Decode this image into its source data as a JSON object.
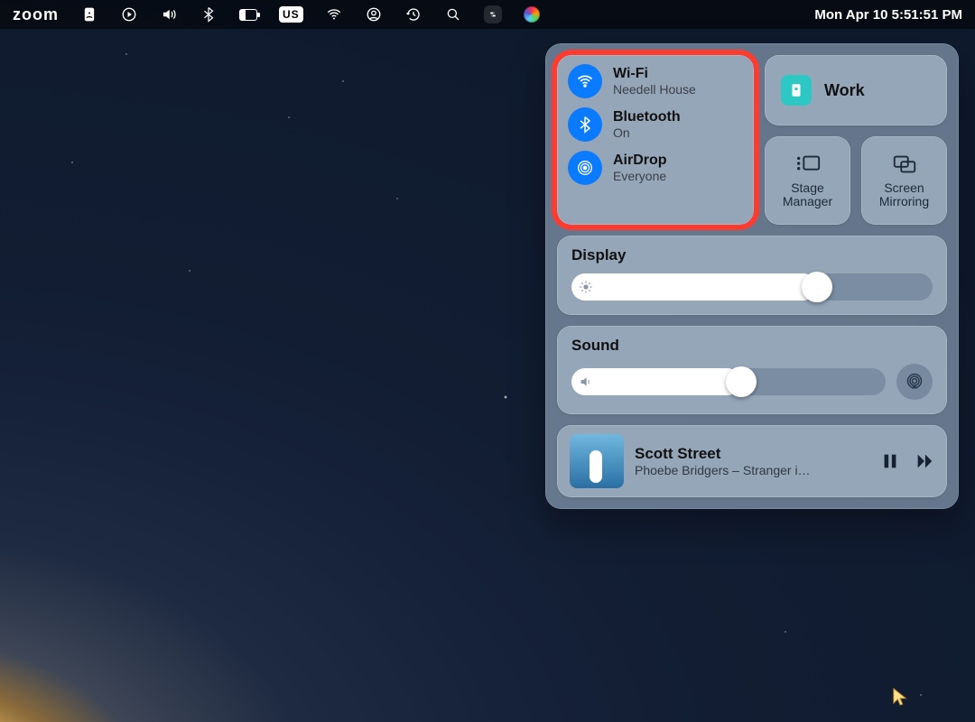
{
  "menubar": {
    "zoom": "zoom",
    "us_label": "US",
    "datetime": "Mon Apr 10  5:51:51 PM"
  },
  "cc": {
    "connectivity": {
      "wifi": {
        "title": "Wi-Fi",
        "subtitle": "Needell House"
      },
      "bluetooth": {
        "title": "Bluetooth",
        "subtitle": "On"
      },
      "airdrop": {
        "title": "AirDrop",
        "subtitle": "Everyone"
      }
    },
    "focus": {
      "label": "Work"
    },
    "mini": {
      "stage": "Stage Manager",
      "mirror": "Screen Mirroring"
    },
    "display": {
      "label": "Display",
      "level": 0.68
    },
    "sound": {
      "label": "Sound",
      "level": 0.54
    },
    "now_playing": {
      "title": "Scott Street",
      "subtitle": "Phoebe Bridgers – Stranger i…"
    }
  }
}
